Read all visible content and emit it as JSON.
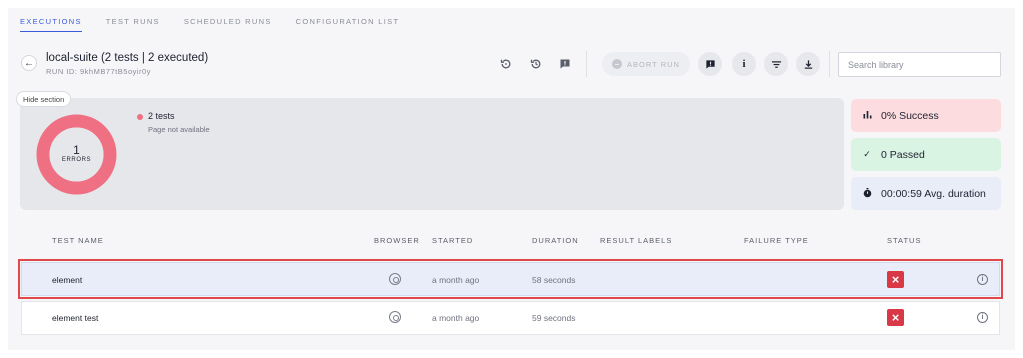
{
  "tabs": [
    {
      "label": "EXECUTIONS",
      "active": true
    },
    {
      "label": "TEST RUNS",
      "active": false
    },
    {
      "label": "SCHEDULED RUNS",
      "active": false
    },
    {
      "label": "CONFIGURATION LIST",
      "active": false
    }
  ],
  "header": {
    "title": "local-suite (2 tests | 2 executed)",
    "run_id": "RUN ID: 9khMB77tB5oyir0y",
    "abort_label": "ABORT RUN",
    "search_placeholder": "Search library"
  },
  "summary": {
    "hide_label": "Hide section",
    "donut_value": "1",
    "donut_label": "ERRORS",
    "legend_label": "2 tests",
    "legend_sub": "Page not available",
    "donut_color": "#f07083"
  },
  "stats": {
    "success": "0% Success",
    "passed": "0 Passed",
    "duration": "00:00:59 Avg. duration"
  },
  "table": {
    "headers": {
      "name": "TEST NAME",
      "browser": "BROWSER",
      "started": "STARTED",
      "duration": "DURATION",
      "labels": "RESULT LABELS",
      "failure": "FAILURE TYPE",
      "status": "STATUS"
    },
    "rows": [
      {
        "name": "element",
        "browser": "chrome-icon",
        "started": "a month ago",
        "duration": "58 seconds",
        "status": "failed",
        "highlighted": true
      },
      {
        "name": "element test",
        "browser": "chrome-icon",
        "started": "a month ago",
        "duration": "59 seconds",
        "status": "failed",
        "highlighted": false
      }
    ]
  },
  "colors": {
    "accent": "#3b5bdb",
    "error": "#d93846",
    "highlight_border": "#e0494b"
  }
}
